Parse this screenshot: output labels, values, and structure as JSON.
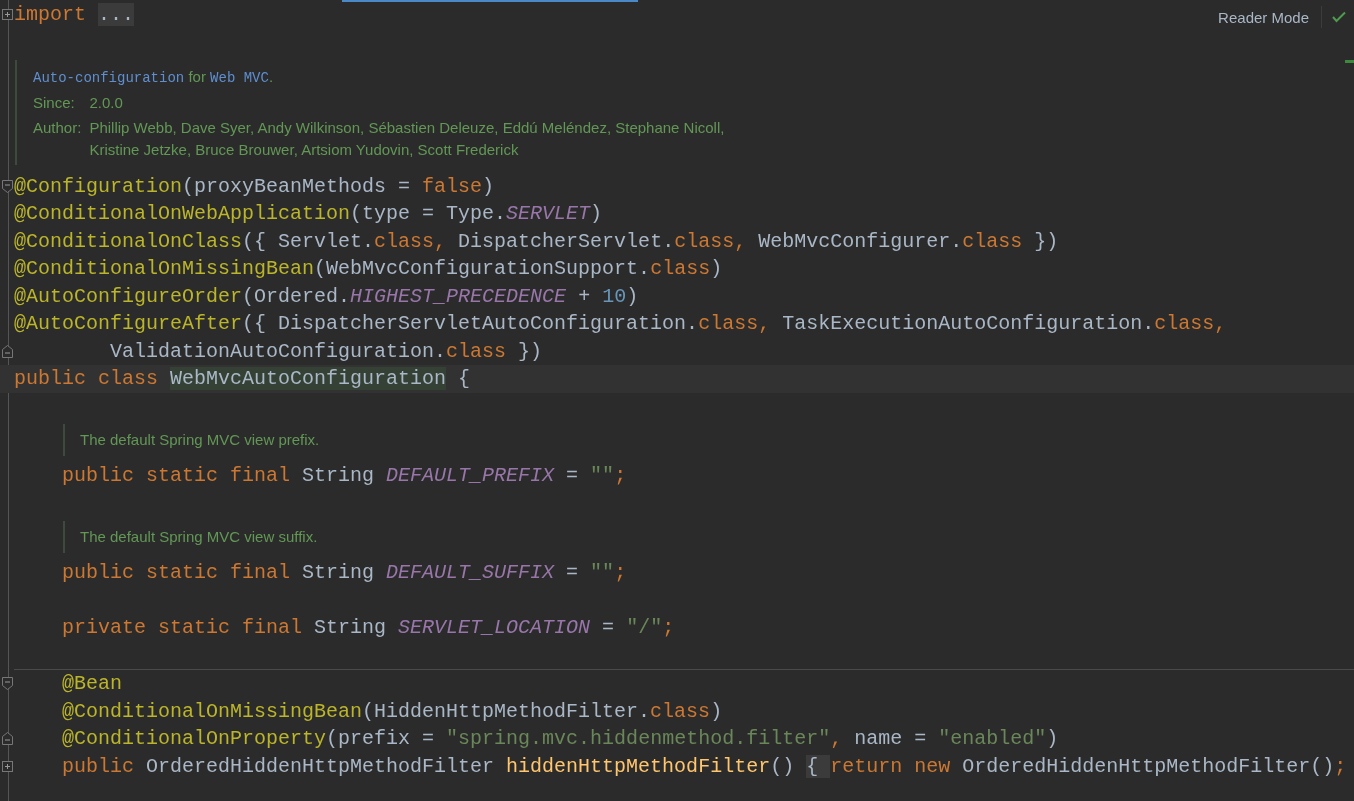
{
  "toolbar": {
    "reader_mode": "Reader Mode"
  },
  "lines": [
    {
      "kind": "code",
      "fold_marker": {
        "kind": "collapsed"
      },
      "current": false,
      "tokens": [
        {
          "kind": "keyword",
          "text": "import "
        },
        {
          "kind": "folded",
          "text": "..."
        }
      ]
    },
    {
      "kind": "doc",
      "indented": false,
      "rows": [
        {
          "tokens": [
            {
              "kind": "code",
              "text": "Auto-configuration"
            },
            {
              "kind": "text",
              "text": " for "
            },
            {
              "kind": "code",
              "text": "Web MVC"
            },
            {
              "kind": "text",
              "text": "."
            }
          ]
        },
        {
          "label": "Since:",
          "values": [
            "2.0.0"
          ]
        },
        {
          "label": "Author:",
          "values": [
            "Phillip Webb, Dave Syer, Andy Wilkinson, Sébastien Deleuze, Eddú Meléndez, Stephane Nicoll,",
            "Kristine Jetzke, Bruce Brouwer, Artsiom Yudovin, Scott Frederick"
          ]
        }
      ]
    },
    {
      "kind": "code",
      "fold_marker": {
        "kind": "start"
      },
      "current": false,
      "tokens": [
        {
          "kind": "annotation",
          "text": "@Configuration"
        },
        {
          "kind": "plain",
          "text": "(proxyBeanMethods = "
        },
        {
          "kind": "keyword",
          "text": "false"
        },
        {
          "kind": "plain",
          "text": ")"
        }
      ]
    },
    {
      "kind": "code",
      "current": false,
      "tokens": [
        {
          "kind": "annotation",
          "text": "@ConditionalOnWebApplication"
        },
        {
          "kind": "plain",
          "text": "(type = Type."
        },
        {
          "kind": "constant",
          "text": "SERVLET"
        },
        {
          "kind": "plain",
          "text": ")"
        }
      ]
    },
    {
      "kind": "code",
      "current": false,
      "tokens": [
        {
          "kind": "annotation",
          "text": "@ConditionalOnClass"
        },
        {
          "kind": "plain",
          "text": "({ Servlet."
        },
        {
          "kind": "keyword",
          "text": "class, "
        },
        {
          "kind": "plain",
          "text": "DispatcherServlet."
        },
        {
          "kind": "keyword",
          "text": "class, "
        },
        {
          "kind": "plain",
          "text": "WebMvcConfigurer."
        },
        {
          "kind": "keyword",
          "text": "class"
        },
        {
          "kind": "plain",
          "text": " })"
        }
      ]
    },
    {
      "kind": "code",
      "current": false,
      "tokens": [
        {
          "kind": "annotation",
          "text": "@ConditionalOnMissingBean"
        },
        {
          "kind": "plain",
          "text": "(WebMvcConfigurationSupport."
        },
        {
          "kind": "keyword",
          "text": "class"
        },
        {
          "kind": "plain",
          "text": ")"
        }
      ]
    },
    {
      "kind": "code",
      "current": false,
      "tokens": [
        {
          "kind": "annotation",
          "text": "@AutoConfigureOrder"
        },
        {
          "kind": "plain",
          "text": "(Ordered."
        },
        {
          "kind": "constant",
          "text": "HIGHEST_PRECEDENCE"
        },
        {
          "kind": "plain",
          "text": " + "
        },
        {
          "kind": "number",
          "text": "10"
        },
        {
          "kind": "plain",
          "text": ")"
        }
      ]
    },
    {
      "kind": "code",
      "current": false,
      "tokens": [
        {
          "kind": "annotation",
          "text": "@AutoConfigureAfter"
        },
        {
          "kind": "plain",
          "text": "({ DispatcherServletAutoConfiguration."
        },
        {
          "kind": "keyword",
          "text": "class, "
        },
        {
          "kind": "plain",
          "text": "TaskExecutionAutoConfiguration."
        },
        {
          "kind": "keyword",
          "text": "class,"
        }
      ]
    },
    {
      "kind": "code",
      "fold_marker": {
        "kind": "end"
      },
      "current": false,
      "tokens": [
        {
          "kind": "plain",
          "text": "        ValidationAutoConfiguration."
        },
        {
          "kind": "keyword",
          "text": "class"
        },
        {
          "kind": "plain",
          "text": " })"
        }
      ]
    },
    {
      "kind": "code",
      "current": true,
      "tokens": [
        {
          "kind": "keyword",
          "text": "public class "
        },
        {
          "kind": "highlighted",
          "text": "WebMvcAutoConfiguration"
        },
        {
          "kind": "plain",
          "text": " {"
        }
      ]
    },
    {
      "kind": "blank"
    },
    {
      "kind": "doc",
      "indented": true,
      "rows": [
        {
          "tokens": [
            {
              "kind": "text",
              "text": "The default Spring MVC view prefix."
            }
          ]
        }
      ]
    },
    {
      "kind": "code",
      "current": false,
      "tokens": [
        {
          "kind": "keyword",
          "text": "    public static final "
        },
        {
          "kind": "plain",
          "text": "String "
        },
        {
          "kind": "constant",
          "text": "DEFAULT_PREFIX"
        },
        {
          "kind": "plain",
          "text": " = "
        },
        {
          "kind": "string",
          "text": "\"\""
        },
        {
          "kind": "keyword",
          "text": ";"
        }
      ]
    },
    {
      "kind": "blank"
    },
    {
      "kind": "doc",
      "indented": true,
      "rows": [
        {
          "tokens": [
            {
              "kind": "text",
              "text": "The default Spring MVC view suffix."
            }
          ]
        }
      ]
    },
    {
      "kind": "code",
      "current": false,
      "tokens": [
        {
          "kind": "keyword",
          "text": "    public static final "
        },
        {
          "kind": "plain",
          "text": "String "
        },
        {
          "kind": "constant",
          "text": "DEFAULT_SUFFIX"
        },
        {
          "kind": "plain",
          "text": " = "
        },
        {
          "kind": "string",
          "text": "\"\""
        },
        {
          "kind": "keyword",
          "text": ";"
        }
      ]
    },
    {
      "kind": "blank"
    },
    {
      "kind": "code",
      "current": false,
      "tokens": [
        {
          "kind": "keyword",
          "text": "    private static final "
        },
        {
          "kind": "plain",
          "text": "String "
        },
        {
          "kind": "constant",
          "text": "SERVLET_LOCATION"
        },
        {
          "kind": "plain",
          "text": " = "
        },
        {
          "kind": "string",
          "text": "\"/\""
        },
        {
          "kind": "keyword",
          "text": ";"
        }
      ]
    },
    {
      "kind": "blank"
    },
    {
      "kind": "separator"
    },
    {
      "kind": "code",
      "fold_marker": {
        "kind": "start"
      },
      "current": false,
      "tokens": [
        {
          "kind": "annotation",
          "text": "    @Bean"
        }
      ]
    },
    {
      "kind": "code",
      "current": false,
      "tokens": [
        {
          "kind": "annotation",
          "text": "    @ConditionalOnMissingBean"
        },
        {
          "kind": "plain",
          "text": "(HiddenHttpMethodFilter."
        },
        {
          "kind": "keyword",
          "text": "class"
        },
        {
          "kind": "plain",
          "text": ")"
        }
      ]
    },
    {
      "kind": "code",
      "fold_marker": {
        "kind": "end"
      },
      "current": false,
      "tokens": [
        {
          "kind": "annotation",
          "text": "    @ConditionalOnProperty"
        },
        {
          "kind": "plain",
          "text": "(prefix = "
        },
        {
          "kind": "string",
          "text": "\"spring.mvc.hiddenmethod.filter\""
        },
        {
          "kind": "keyword",
          "text": ", "
        },
        {
          "kind": "plain",
          "text": "name = "
        },
        {
          "kind": "string",
          "text": "\"enabled\""
        },
        {
          "kind": "plain",
          "text": ")"
        }
      ]
    },
    {
      "kind": "code",
      "fold_marker": {
        "kind": "collapsed"
      },
      "current": false,
      "tokens": [
        {
          "kind": "keyword",
          "text": "    public "
        },
        {
          "kind": "plain",
          "text": "OrderedHiddenHttpMethodFilter "
        },
        {
          "kind": "method",
          "text": "hiddenHttpMethodFilter"
        },
        {
          "kind": "plain",
          "text": "() "
        },
        {
          "kind": "folded",
          "text": "{ "
        },
        {
          "kind": "keyword",
          "text": "return new "
        },
        {
          "kind": "plain",
          "text": "OrderedHiddenHttpMethodFilter()"
        },
        {
          "kind": "keyword",
          "text": ";"
        }
      ]
    }
  ]
}
